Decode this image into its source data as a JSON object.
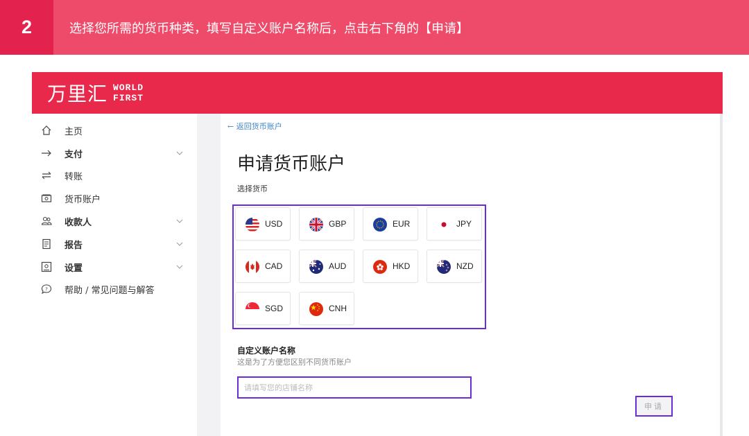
{
  "banner": {
    "step": "2",
    "instruction": "选择您所需的货币种类，填写自定义账户名称后，点击右下角的【申请】"
  },
  "app": {
    "logo_cn": "万里汇",
    "logo_en_line1": "WORLD",
    "logo_en_line2": "FIRST",
    "brand_color": "#e8294c"
  },
  "sidebar": {
    "items": [
      {
        "label": "主页",
        "icon": "home-icon",
        "has_submenu": false
      },
      {
        "label": "支付",
        "icon": "arrow-right-icon",
        "has_submenu": true
      },
      {
        "label": "转账",
        "icon": "swap-icon",
        "has_submenu": false
      },
      {
        "label": "货币账户",
        "icon": "wallet-icon",
        "has_submenu": false
      },
      {
        "label": "收款人",
        "icon": "users-icon",
        "has_submenu": true
      },
      {
        "label": "报告",
        "icon": "report-icon",
        "has_submenu": true
      },
      {
        "label": "设置",
        "icon": "settings-icon",
        "has_submenu": true
      },
      {
        "label": "帮助 / 常见问题与解答",
        "icon": "help-icon",
        "has_submenu": false
      }
    ]
  },
  "main": {
    "back_link": "返回货币账户",
    "title": "申请货币账户",
    "select_currency_label": "选择货币",
    "currencies": [
      {
        "code": "USD",
        "icon": "us-flag-icon"
      },
      {
        "code": "GBP",
        "icon": "uk-flag-icon"
      },
      {
        "code": "EUR",
        "icon": "eu-flag-icon"
      },
      {
        "code": "JPY",
        "icon": "japan-flag-icon"
      },
      {
        "code": "CAD",
        "icon": "canada-flag-icon"
      },
      {
        "code": "AUD",
        "icon": "australia-flag-icon"
      },
      {
        "code": "HKD",
        "icon": "hong-kong-flag-icon"
      },
      {
        "code": "NZD",
        "icon": "new-zealand-flag-icon"
      },
      {
        "code": "SGD",
        "icon": "singapore-flag-icon"
      },
      {
        "code": "CNH",
        "icon": "china-flag-icon"
      }
    ],
    "custom_name_label": "自定义账户名称",
    "custom_name_help": "这是为了方便您区别不同货币账户",
    "custom_name_placeholder": "请填写您的店铺名称",
    "custom_name_value": "",
    "apply_button": "申请",
    "highlight_color": "#6a2bd9"
  }
}
